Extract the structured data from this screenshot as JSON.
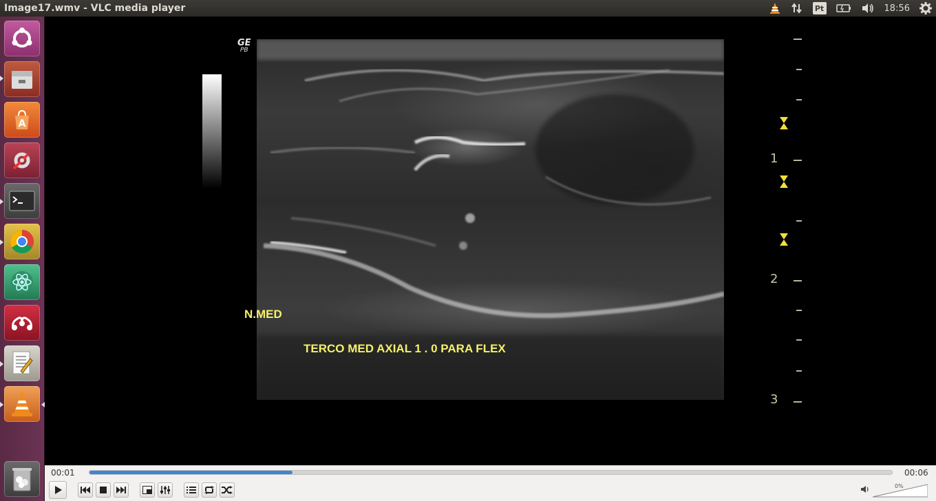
{
  "window": {
    "title": "Image17.wmv - VLC media player"
  },
  "indicators": {
    "vlc_icon": "vlc-cone-icon",
    "network_icon": "network-arrows-icon",
    "keyboard_layout": "Pt",
    "battery_icon": "battery-icon",
    "volume_icon": "speaker-icon",
    "clock": "18:56",
    "settings_icon": "gear-icon"
  },
  "launcher": [
    {
      "name": "ubuntu-dash-icon",
      "color": "#b0478f"
    },
    {
      "name": "files-icon",
      "color": "#b3432f"
    },
    {
      "name": "software-center-icon",
      "color": "#e2622b"
    },
    {
      "name": "system-settings-icon",
      "color": "#a8344a"
    },
    {
      "name": "terminal-icon",
      "color": "#555555"
    },
    {
      "name": "chrome-icon",
      "color": "#c8a536"
    },
    {
      "name": "atom-icon",
      "color": "#3aa575"
    },
    {
      "name": "mendeley-icon",
      "color": "#b52033"
    },
    {
      "name": "text-editor-icon",
      "color": "#b7b2a8"
    },
    {
      "name": "vlc-icon",
      "color": "#e0761f"
    },
    {
      "name": "trash-icon",
      "color": "#555555"
    }
  ],
  "video": {
    "logo": "GE",
    "logo_sub": "PB",
    "label_nerve": "N.MED",
    "label_caption": "TERCO MED AXIAL 1 . 0 PARA FLEX",
    "depth_labels": [
      "1",
      "2",
      "3"
    ],
    "overlay_color": "#f5f06a"
  },
  "controls": {
    "time_elapsed": "00:01",
    "time_total": "00:06",
    "progress": 0.253,
    "volume_percent": "0%",
    "buttons": {
      "play": "play-icon",
      "previous": "previous-icon",
      "stop": "stop-icon",
      "next": "next-icon",
      "fullscreen": "fullscreen-icon",
      "extended": "equalizer-icon",
      "playlist": "playlist-icon",
      "loop": "loop-icon",
      "random": "shuffle-icon"
    },
    "accent": "#3d86d3"
  }
}
